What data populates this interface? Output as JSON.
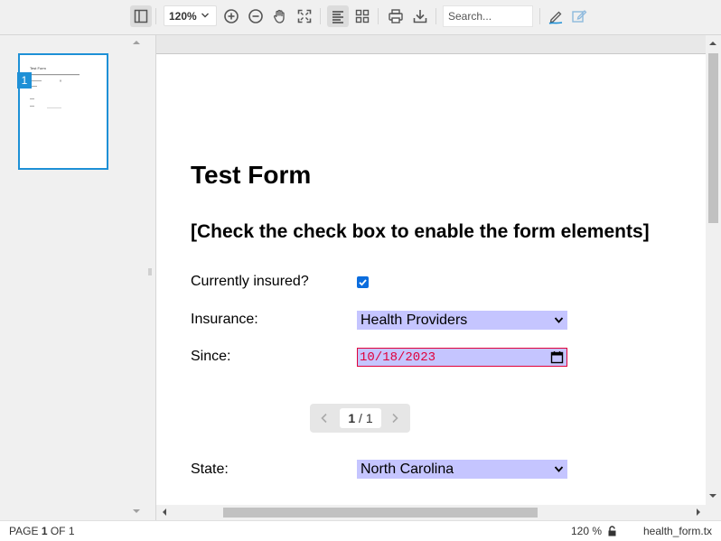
{
  "toolbar": {
    "zoom_value": "120%",
    "search_placeholder": "Search..."
  },
  "sidebar": {
    "thumbnail_page_number": "1",
    "thumbnail_title": "Test Form"
  },
  "form": {
    "title": "Test Form",
    "subtitle": "[Check the check box to enable the form elements]",
    "fields": {
      "insured_label": "Currently insured?",
      "insured_checked": true,
      "insurance_label": "Insurance:",
      "insurance_value": "Health Providers",
      "since_label": "Since:",
      "since_value": "10/18/2023",
      "state_label": "State:",
      "state_value": "North Carolina"
    }
  },
  "pager": {
    "current": "1",
    "separator": "/",
    "total": "1"
  },
  "status": {
    "page_prefix": "PAGE",
    "page_current": "1",
    "page_of": "OF",
    "page_total": "1",
    "zoom": "120 %",
    "filename": "health_form.tx"
  },
  "colors": {
    "accent": "#1e90d6",
    "field_background": "#c5c5ff",
    "invalid_border": "#e0003a",
    "checkbox": "#0b6dde"
  },
  "icons": [
    "sidebar-toggle-icon",
    "chevron-down-icon",
    "zoom-in-icon",
    "zoom-out-icon",
    "pan-hand-icon",
    "fit-page-icon",
    "single-page-icon",
    "thumbnail-grid-icon",
    "print-icon",
    "download-icon",
    "annotate-pen-icon",
    "edit-form-icon",
    "lock-icon",
    "calendar-icon"
  ]
}
